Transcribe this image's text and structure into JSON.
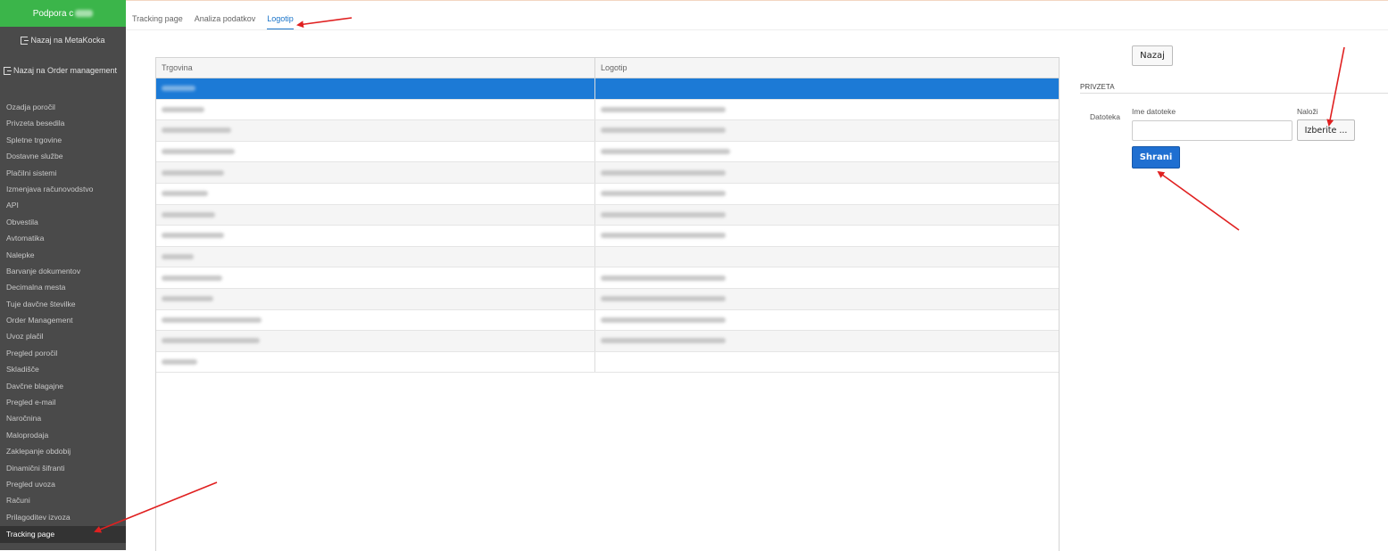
{
  "sidebar": {
    "brand": "Podpora c",
    "back_metakocka": "Nazaj na MetaKocka",
    "back_order_mgmt": "Nazaj na Order management",
    "items": [
      {
        "label": "Ozadja poročil"
      },
      {
        "label": "Privzeta besedila"
      },
      {
        "label": "Spletne trgovine"
      },
      {
        "label": "Dostavne službe"
      },
      {
        "label": "Plačilni sistemi"
      },
      {
        "label": "Izmenjava računovodstvo"
      },
      {
        "label": "API"
      },
      {
        "label": "Obvestila"
      },
      {
        "label": "Avtomatika"
      },
      {
        "label": "Nalepke"
      },
      {
        "label": "Barvanje dokumentov"
      },
      {
        "label": "Decimalna mesta"
      },
      {
        "label": "Tuje davčne številke"
      },
      {
        "label": "Order Management"
      },
      {
        "label": "Uvoz plačil"
      },
      {
        "label": "Pregled poročil"
      },
      {
        "label": "Skladišče"
      },
      {
        "label": "Davčne blagajne"
      },
      {
        "label": "Pregled e-mail"
      },
      {
        "label": "Naročnina"
      },
      {
        "label": "Maloprodaja"
      },
      {
        "label": "Zaklepanje obdobij"
      },
      {
        "label": "Dinamični šifranti"
      },
      {
        "label": "Pregled uvoza"
      },
      {
        "label": "Računi"
      },
      {
        "label": "Prilagoditev izvoza"
      },
      {
        "label": "Tracking page"
      }
    ]
  },
  "tabs": [
    {
      "label": "Tracking page"
    },
    {
      "label": "Analiza podatkov"
    },
    {
      "label": "Logotip"
    }
  ],
  "table": {
    "headers": [
      "Trgovina",
      "Logotip"
    ]
  },
  "panel": {
    "back_label": "Nazaj",
    "section_title": "PRIVZETA",
    "file_label": "Datoteka",
    "name_label": "Ime datoteke",
    "upload_label": "Naloži",
    "choose_label": "Izberite ...",
    "save_label": "Shrani"
  },
  "colors": {
    "brand_green": "#3bb54a",
    "sidebar_bg": "#4a4a4a",
    "selection_blue": "#1c7ad6",
    "primary_button": "#1f6fd1",
    "annotation_arrow": "#e02020"
  }
}
